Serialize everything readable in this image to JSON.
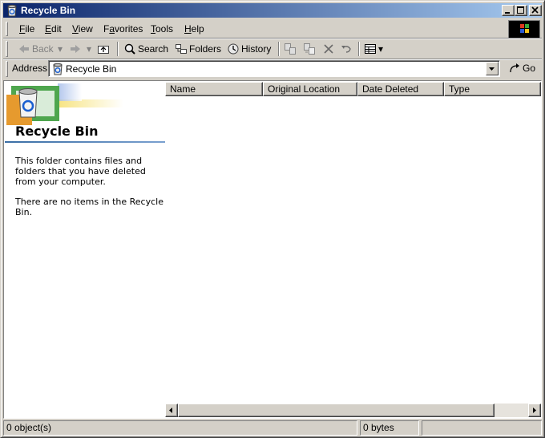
{
  "window": {
    "title": "Recycle Bin",
    "title_icon": "recycle-bin-icon",
    "controls": [
      "minimize-icon",
      "maximize-icon",
      "close-icon"
    ]
  },
  "menu": {
    "items": [
      {
        "label": "File",
        "accel": "F"
      },
      {
        "label": "Edit",
        "accel": "E"
      },
      {
        "label": "View",
        "accel": "V"
      },
      {
        "label": "Favorites",
        "accel": "a"
      },
      {
        "label": "Tools",
        "accel": "T"
      },
      {
        "label": "Help",
        "accel": "H"
      }
    ]
  },
  "toolbar": {
    "back_label": "Back",
    "search_label": "Search",
    "folders_label": "Folders",
    "history_label": "History"
  },
  "address": {
    "label": "Address",
    "value": "Recycle Bin",
    "go_label": "Go"
  },
  "left_pane": {
    "title": "Recycle Bin",
    "description": "This folder contains files and folders that you have deleted from your computer.",
    "empty_message": "There are no items in the Recycle Bin."
  },
  "list": {
    "columns": [
      "Name",
      "Original Location",
      "Date Deleted",
      "Type"
    ]
  },
  "status": {
    "objects": "0 object(s)",
    "size": "0 bytes"
  },
  "colors": {
    "title_bar_start": "#0a246a",
    "title_bar_end": "#a6caf0",
    "face": "#d4d0c8"
  }
}
